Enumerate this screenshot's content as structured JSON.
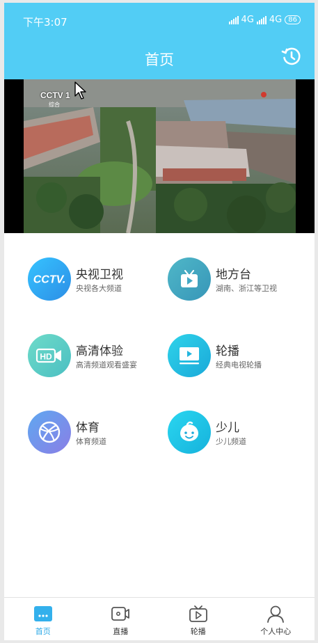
{
  "status_bar": {
    "time": "下午3:07",
    "network1": "4G",
    "network2": "4G",
    "battery": "86"
  },
  "header": {
    "title": "首页",
    "history_icon": "history-clock-icon"
  },
  "video": {
    "channel_logo": "CCTV 1",
    "channel_sub": "综合"
  },
  "categories": [
    {
      "name": "央视卫视",
      "desc": "央视各大频道",
      "icon": "cctv-logo-icon",
      "color": "#3aaef0"
    },
    {
      "name": "地方台",
      "desc": "湖南、浙江等卫视",
      "icon": "tv-play-icon",
      "color": "#4bb3c7"
    },
    {
      "name": "高清体验",
      "desc": "高清频道观看盛宴",
      "icon": "hd-camera-icon",
      "color": "#5bcfc4"
    },
    {
      "name": "轮播",
      "desc": "经典电视轮播",
      "icon": "carousel-play-icon",
      "color": "#2cc6df"
    },
    {
      "name": "体育",
      "desc": "体育频道",
      "icon": "basketball-icon",
      "color": "#6b8fea"
    },
    {
      "name": "少儿",
      "desc": "少儿频道",
      "icon": "child-face-icon",
      "color": "#26c6e6"
    }
  ],
  "tabbar": {
    "items": [
      {
        "label": "首页",
        "icon": "home-icon"
      },
      {
        "label": "直播",
        "icon": "live-camera-icon"
      },
      {
        "label": "轮播",
        "icon": "carousel-tv-icon"
      },
      {
        "label": "个人中心",
        "icon": "person-icon"
      }
    ],
    "active_color": "#2aa8e6"
  }
}
